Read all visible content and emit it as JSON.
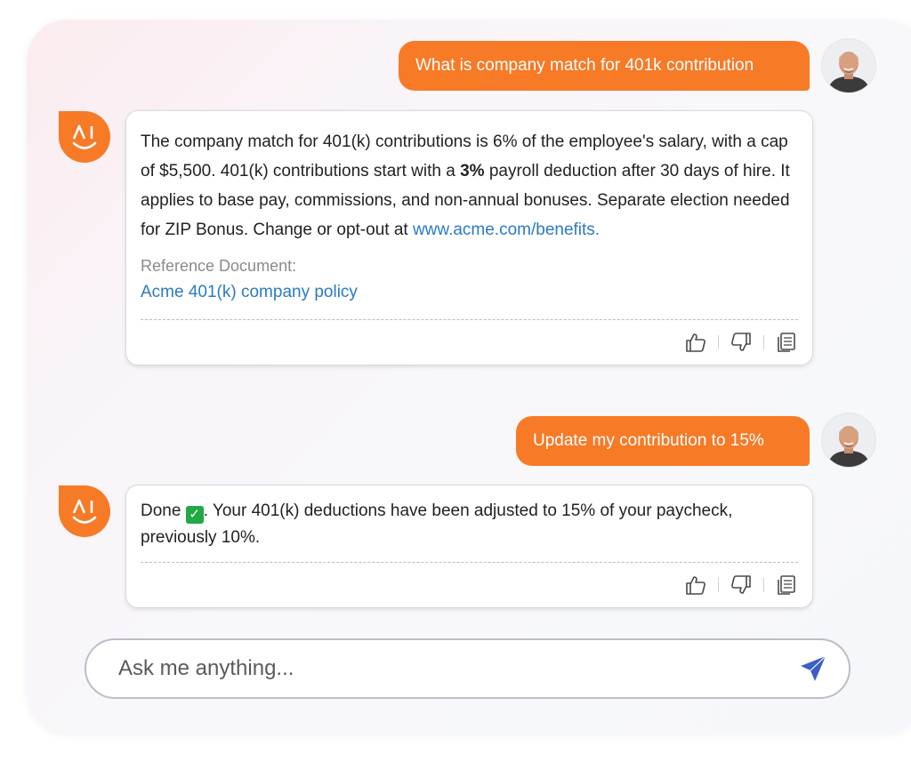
{
  "conversation": {
    "messages": [
      {
        "role": "user",
        "text": "What is company match for 401k contribution"
      },
      {
        "role": "assistant",
        "text_part1": "The company match for 401(k) contributions is 6% of the employee's salary, with a cap of $5,500. 401(k) contributions start with a ",
        "text_bold": "3%",
        "text_part2": " payroll deduction after 30 days of hire. It applies to base pay, commissions, and non-annual bonuses. Separate election needed for ZIP Bonus. Change or opt-out at ",
        "link": "www.acme.com/benefits.",
        "reference_label": "Reference Document:",
        "reference_link": "Acme 401(k) company policy"
      },
      {
        "role": "user",
        "text": "Update my contribution to 15%"
      },
      {
        "role": "assistant",
        "text_part1": "Done",
        "text_part2": ". Your 401(k) deductions have been adjusted to 15% of your paycheck, previously 10%."
      }
    ]
  },
  "logo": {
    "text": "AI"
  },
  "icons": {
    "like": "thumbs-up-icon",
    "dislike": "thumbs-down-icon",
    "copy": "copy-icon",
    "check": "check-mark-icon",
    "send": "send-icon"
  },
  "input": {
    "placeholder": "Ask me anything..."
  },
  "colors": {
    "accent": "#f77a26",
    "link": "#2a7bc2",
    "send": "#3b5fc6"
  }
}
